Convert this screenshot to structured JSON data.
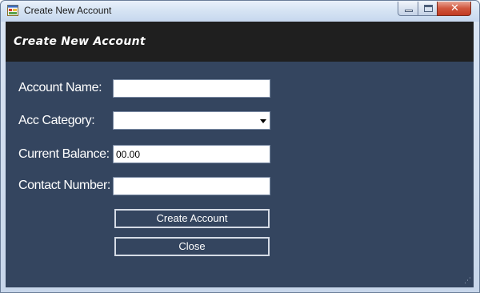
{
  "window": {
    "title": "Create New Account",
    "controls": {
      "minimize_icon": "minimize-icon",
      "maximize_icon": "maximize-icon",
      "close_icon": "close-icon",
      "close_glyph": "✕"
    }
  },
  "header": {
    "title": "Create New Account"
  },
  "form": {
    "account_name": {
      "label": "Account Name:",
      "value": ""
    },
    "acc_category": {
      "label": "Acc Category:",
      "value": ""
    },
    "current_balance": {
      "label": "Current Balance:",
      "value": "00.00"
    },
    "contact_number": {
      "label": "Contact Number:",
      "value": ""
    }
  },
  "buttons": {
    "create": "Create Account",
    "close": "Close"
  },
  "colors": {
    "client_bg": "#34455f",
    "header_bg": "#1f1f1f",
    "button_border": "#d5dbe5"
  }
}
